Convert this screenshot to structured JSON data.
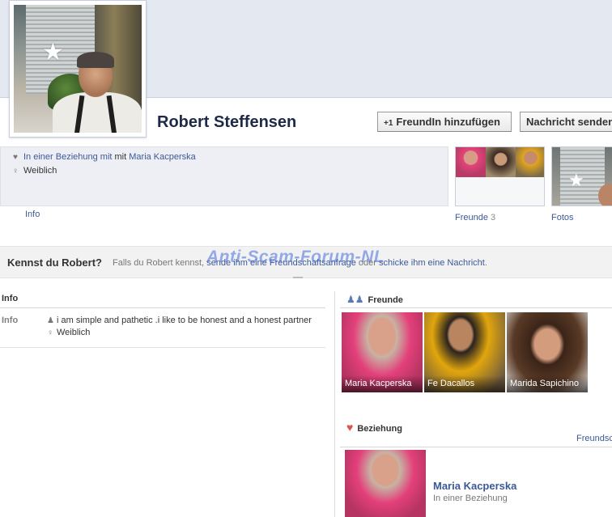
{
  "profile": {
    "name": "Robert Steffensen"
  },
  "actions": {
    "add_friend": "FreundIn hinzufügen",
    "add_friend_icon": "+1",
    "message": "Nachricht senden"
  },
  "intro": {
    "relationship_prefix": "In einer Beziehung mit",
    "relationship_partner": "Maria Kacperska",
    "gender": "Weiblich",
    "info_tab": "Info"
  },
  "tiles": {
    "friends_label": "Freunde",
    "friends_count": "3",
    "photos_label": "Fotos"
  },
  "know_bar": {
    "title": "Kennst du Robert?",
    "prefix": "Falls du Robert kennst,",
    "link1": "sende ihm eine Freundschaftsanfrage",
    "middle": "oder",
    "link2": "schicke ihm eine Nachricht",
    "suffix": "."
  },
  "watermark": "Anti-Scam-Forum-NL",
  "info_section": {
    "heading": "Info",
    "label": "Info",
    "about": "i am simple and pathetic .i like to be honest and a honest partner",
    "gender": "Weiblich"
  },
  "friends_section": {
    "heading": "Freunde",
    "friends": [
      {
        "name": "Maria Kacperska"
      },
      {
        "name": "Fe Dacallos"
      },
      {
        "name": "Marida Sapichino"
      }
    ]
  },
  "relationship_section": {
    "heading": "Beziehung",
    "right_link": "Freundschaft",
    "partner_name": "Maria Kacperska",
    "status": "In einer Beziehung"
  },
  "colors": {
    "link": "#3b5998",
    "cover": "#e4e8f1",
    "info_bg": "#edeff4"
  }
}
